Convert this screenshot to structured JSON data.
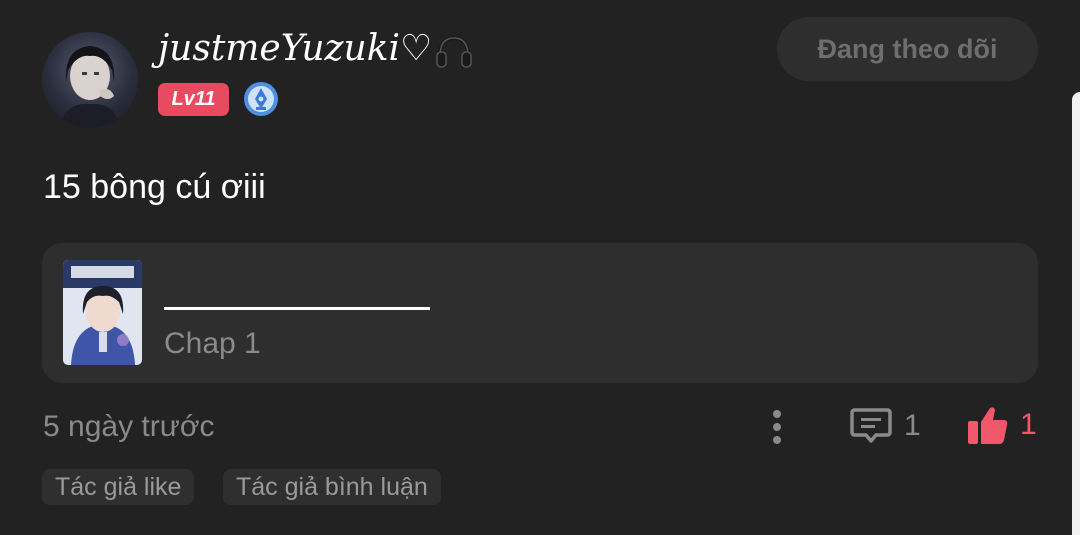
{
  "comment": {
    "user": {
      "name": "justmeYuzuki♡",
      "level_badge": "Lv11",
      "avatar_icon": "profile-photo"
    },
    "follow_label": "Đang theo dõi",
    "text": "15 bông cú ơiii",
    "chapter_card": {
      "subtitle": "Chap 1"
    },
    "time_ago": "5 ngày trước",
    "comment_count": "1",
    "like_count": "1",
    "tags": [
      "Tác giả like",
      "Tác giả bình luận"
    ]
  },
  "colors": {
    "background": "#222222",
    "card": "#2e2e2e",
    "level_badge": "#e84a5f",
    "like_accent": "#f1576b",
    "muted_text": "#8a8a8a"
  }
}
